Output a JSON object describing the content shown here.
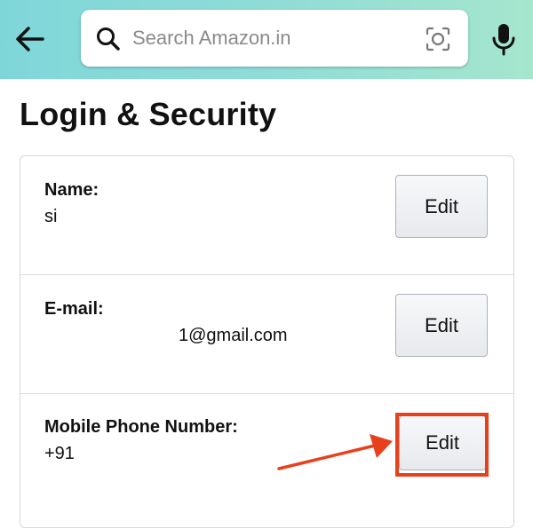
{
  "header": {
    "back_icon": "back-arrow-icon",
    "search": {
      "placeholder": "Search Amazon.in",
      "value": "",
      "icon": "search-icon",
      "lens_icon": "camera-lens-icon"
    },
    "mic_icon": "microphone-icon",
    "gradient_colors": [
      "#7fd6d9",
      "#a5e6cd"
    ]
  },
  "page": {
    "title": "Login & Security"
  },
  "rows": [
    {
      "label": "Name:",
      "value": "si",
      "button_label": "Edit"
    },
    {
      "label": "E-mail:",
      "value": "1@gmail.com",
      "button_label": "Edit"
    },
    {
      "label": "Mobile Phone Number:",
      "value": "+91",
      "button_label": "Edit"
    }
  ],
  "annotation": {
    "color": "#e8401c",
    "target": "Mobile Phone Number Edit button"
  }
}
